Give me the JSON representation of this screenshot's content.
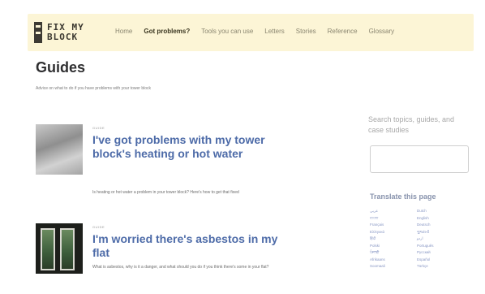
{
  "header": {
    "logo_line1": "FIX MY",
    "logo_line2": "BLOCK",
    "nav": [
      {
        "label": "Home",
        "active": false
      },
      {
        "label": "Got problems?",
        "active": true
      },
      {
        "label": "Tools you can use",
        "active": false
      },
      {
        "label": "Letters",
        "active": false
      },
      {
        "label": "Stories",
        "active": false
      },
      {
        "label": "Reference",
        "active": false
      },
      {
        "label": "Glossary",
        "active": false
      }
    ]
  },
  "main": {
    "title": "Guides",
    "subtitle": "Advice on what to do if you have problems with your tower block",
    "guides": [
      {
        "tag": "GUIDE",
        "title": "I've got problems with my tower block's heating or hot water",
        "description": "Is heating or hot water a problem in your tower block? Here's how to get that fixed"
      },
      {
        "tag": "GUIDE",
        "title": "I'm worried there's asbestos in my flat",
        "description": "What is asbestos, why is it a danger, and what should you do if you think there's some in your flat?"
      }
    ]
  },
  "sidebar": {
    "search_label": "Search topics, guides, and case studies",
    "search_value": "",
    "translate_title": "Translate this page",
    "languages": [
      "عربي",
      "Dutch",
      "বাংলা",
      "English",
      "Français",
      "Deutsch",
      "Ελληνικά",
      "ગુજરાતી",
      "हिंदी",
      "اردو",
      "Polski",
      "Português",
      "ਪੰਜਾਬੀ",
      "Русский",
      "Afrikaans",
      "Español",
      "Soomaali",
      "Türkçe"
    ]
  }
}
